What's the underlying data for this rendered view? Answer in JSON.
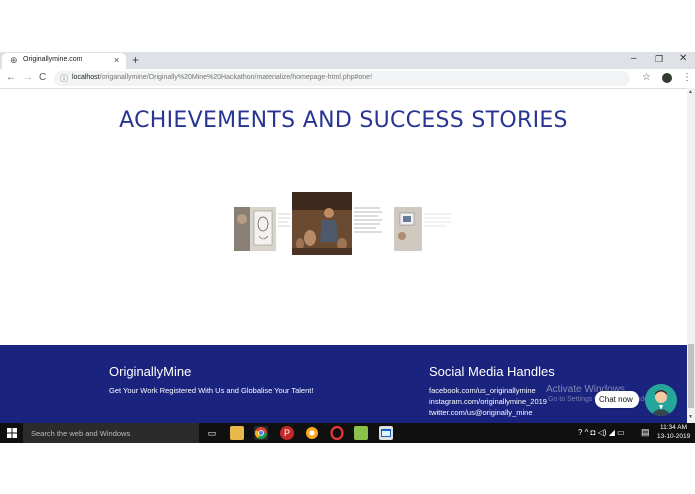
{
  "browser": {
    "tab_title": "Originallymine.com",
    "tab_close": "×",
    "new_tab": "+",
    "url_host": "localhost",
    "url_path": "/origanallymine/Originally%20Mine%20Hackathon/materialize/homepage-html.php#one!",
    "window_controls": {
      "minimize": "–",
      "maximize": "❐",
      "close": "✕"
    },
    "nav": {
      "back": "←",
      "forward": "→",
      "reload": "C"
    },
    "menu": "⋮",
    "star": "☆"
  },
  "page": {
    "heading": "ACHIEVEMENTS AND SUCCESS STORIES",
    "carousel": {
      "items": [
        {
          "name": "portrait-sketch-card"
        },
        {
          "name": "pottery-artisan-card"
        },
        {
          "name": "painting-artist-card"
        }
      ]
    }
  },
  "footer": {
    "brand_title": "OriginallyMine",
    "brand_tagline": "Get Your Work Registered With Us and Globalise Your Talent!",
    "social_title": "Social Media Handles",
    "social_links": [
      "facebook.com/us_originallymine",
      "instagram.com/originallymine_2019",
      "twitter.com/us@originally_mine"
    ],
    "watermark_line1": "Activate Windows",
    "watermark_line2": "Go to Settings to activate Windows.",
    "chat_label": "Chat now"
  },
  "taskbar": {
    "search_placeholder": "Search the web and Windows",
    "time": "11:34 AM",
    "date": "13-10-2019",
    "tray": "? ^ ◘ ◁) ◢ ▭"
  },
  "colors": {
    "heading": "#283593",
    "footer_bg": "#1a237e",
    "chat_avatar": "#26a69a"
  }
}
